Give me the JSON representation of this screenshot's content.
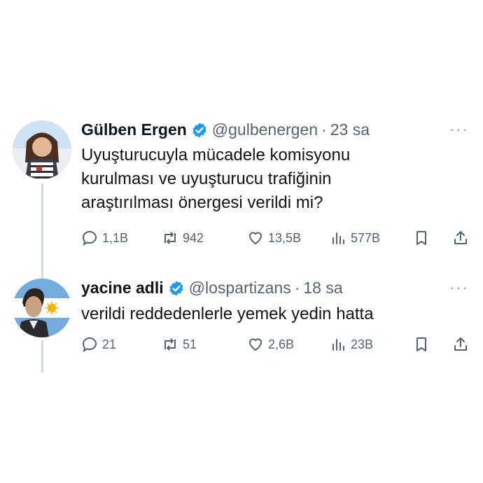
{
  "tweets": [
    {
      "name": "Gülben Ergen",
      "handle": "@gulbenergen",
      "time": "23 sa",
      "text_lines": [
        "Uyuşturucuyla mücadele komisyonu",
        "kurulması ve uyuşturucu trafiğinin",
        "araştırılması önergesi verildi mi?"
      ],
      "replies": "1,1B",
      "retweets": "942",
      "likes": "13,5B",
      "views": "577B"
    },
    {
      "name": "yacine adli",
      "handle": "@lospartizans",
      "time": "18 sa",
      "text_lines": [
        "verildi reddedenlerle yemek yedin hatta"
      ],
      "replies": "21",
      "retweets": "51",
      "likes": "2,6B",
      "views": "23B"
    }
  ],
  "separator": "·",
  "more_glyph": "···",
  "colors": {
    "verified": "#1d9bf0",
    "muted": "#536471",
    "line": "#cfd9de"
  },
  "icons": [
    "verified-badge-icon",
    "reply-icon",
    "retweet-icon",
    "like-icon",
    "views-icon",
    "bookmark-icon",
    "share-icon",
    "more-icon"
  ]
}
